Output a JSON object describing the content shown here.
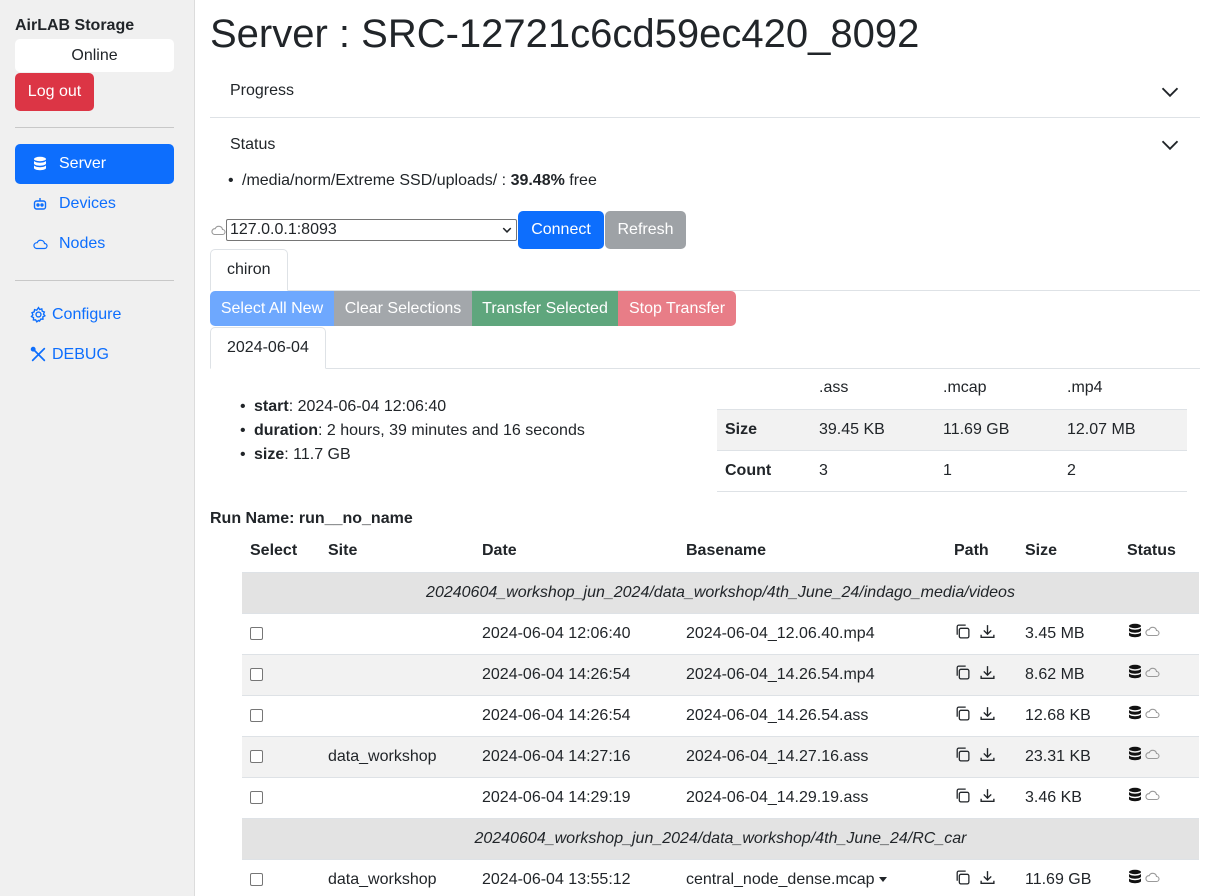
{
  "sidebar": {
    "app_title": "AirLAB Storage",
    "status": "Online",
    "logout_label": "Log out",
    "nav": [
      {
        "label": "Server",
        "icon": "database-icon",
        "active": true
      },
      {
        "label": "Devices",
        "icon": "robot-icon",
        "active": false
      },
      {
        "label": "Nodes",
        "icon": "cloud-icon",
        "active": false
      }
    ],
    "links": [
      {
        "label": "Configure",
        "icon": "gear-icon"
      },
      {
        "label": "DEBUG",
        "icon": "tools-icon"
      }
    ]
  },
  "header": {
    "title": "Server : SRC-12721c6cd59ec420_8092"
  },
  "accordion": {
    "progress_label": "Progress",
    "status_label": "Status"
  },
  "disk": {
    "path": "/media/norm/Extreme SSD/uploads/ : ",
    "free_pct": "39.48%",
    "suffix": " free"
  },
  "server_select": {
    "value": "127.0.0.1:8093",
    "connect_label": "Connect",
    "refresh_label": "Refresh"
  },
  "robot_tab": "chiron",
  "actions": {
    "select_all_new": "Select All New",
    "clear_selections": "Clear Selections",
    "transfer_selected": "Transfer Selected",
    "stop_transfer": "Stop Transfer"
  },
  "date_tab": "2024-06-04",
  "summary": {
    "start_label": "start",
    "start_value": ": 2024-06-04 12:06:40",
    "duration_label": "duration",
    "duration_value": ": 2 hours, 39 minutes and 16 seconds",
    "size_label": "size",
    "size_value": ": 11.7 GB"
  },
  "ext_table": {
    "headers": [
      ".ass",
      ".mcap",
      ".mp4"
    ],
    "rows": [
      {
        "label": "Size",
        "values": [
          "39.45 KB",
          "11.69 GB",
          "12.07 MB"
        ]
      },
      {
        "label": "Count",
        "values": [
          "3",
          "1",
          "2"
        ]
      }
    ]
  },
  "run_name": "Run Name: run__no_name",
  "files": {
    "headers": [
      "Select",
      "Site",
      "Date",
      "Basename",
      "Path",
      "Size",
      "Status"
    ],
    "groups": [
      {
        "path": "20240604_workshop_jun_2024/data_workshop/4th_June_24/indago_media/videos",
        "rows": [
          {
            "site": "",
            "date": "2024-06-04 12:06:40",
            "basename": "2024-06-04_12.06.40.mp4",
            "size": "3.45 MB"
          },
          {
            "site": "",
            "date": "2024-06-04 14:26:54",
            "basename": "2024-06-04_14.26.54.mp4",
            "size": "8.62 MB"
          },
          {
            "site": "",
            "date": "2024-06-04 14:26:54",
            "basename": "2024-06-04_14.26.54.ass",
            "size": "12.68 KB"
          },
          {
            "site": "data_workshop",
            "date": "2024-06-04 14:27:16",
            "basename": "2024-06-04_14.27.16.ass",
            "size": "23.31 KB"
          },
          {
            "site": "",
            "date": "2024-06-04 14:29:19",
            "basename": "2024-06-04_14.29.19.ass",
            "size": "3.46 KB"
          }
        ]
      },
      {
        "path": "20240604_workshop_jun_2024/data_workshop/4th_June_24/RC_car",
        "rows": [
          {
            "site": "data_workshop",
            "date": "2024-06-04 13:55:12",
            "basename": "central_node_dense.mcap",
            "size": "11.69 GB"
          }
        ]
      }
    ]
  }
}
